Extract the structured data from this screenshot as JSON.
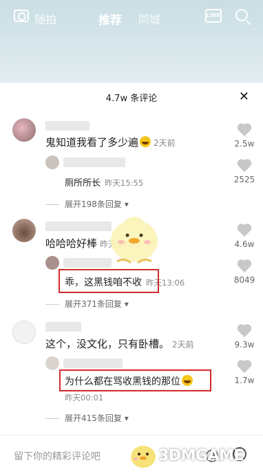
{
  "top_nav": {
    "tabs": [
      "随拍",
      "推荐",
      "同城"
    ],
    "live_label": "LIVE"
  },
  "panel": {
    "comment_count": "4.7w 条评论",
    "close_glyph": "✕"
  },
  "comments": [
    {
      "text": "鬼知道我看了多少遍",
      "time": "2天前",
      "reply": {
        "text": "厕所所长",
        "time": "昨天15:55",
        "likes": "2525"
      },
      "expand": "展开198条回复",
      "likes": "2.5w"
    },
    {
      "text": "哈哈哈好棒",
      "time": "昨天09:35",
      "reply": {
        "text": "乖，这黑钱咱不收",
        "time": "昨天13:06",
        "likes": "8049"
      },
      "expand": "展开371条回复",
      "likes": "4.6w"
    },
    {
      "text": "这个，没文化，只有卧槽。",
      "time": "2天前",
      "reply": {
        "text": "为什么都在骂收黑钱的那位",
        "time": "昨天00:01",
        "likes": "1.7w"
      },
      "expand": "展开415条回复",
      "likes": "9.3w"
    }
  ],
  "input": {
    "placeholder": "留下你的精彩评论吧",
    "at_glyph": "@"
  },
  "watermark": "3DMGAME",
  "colors": {
    "highlight_box": "#d22a2a"
  }
}
